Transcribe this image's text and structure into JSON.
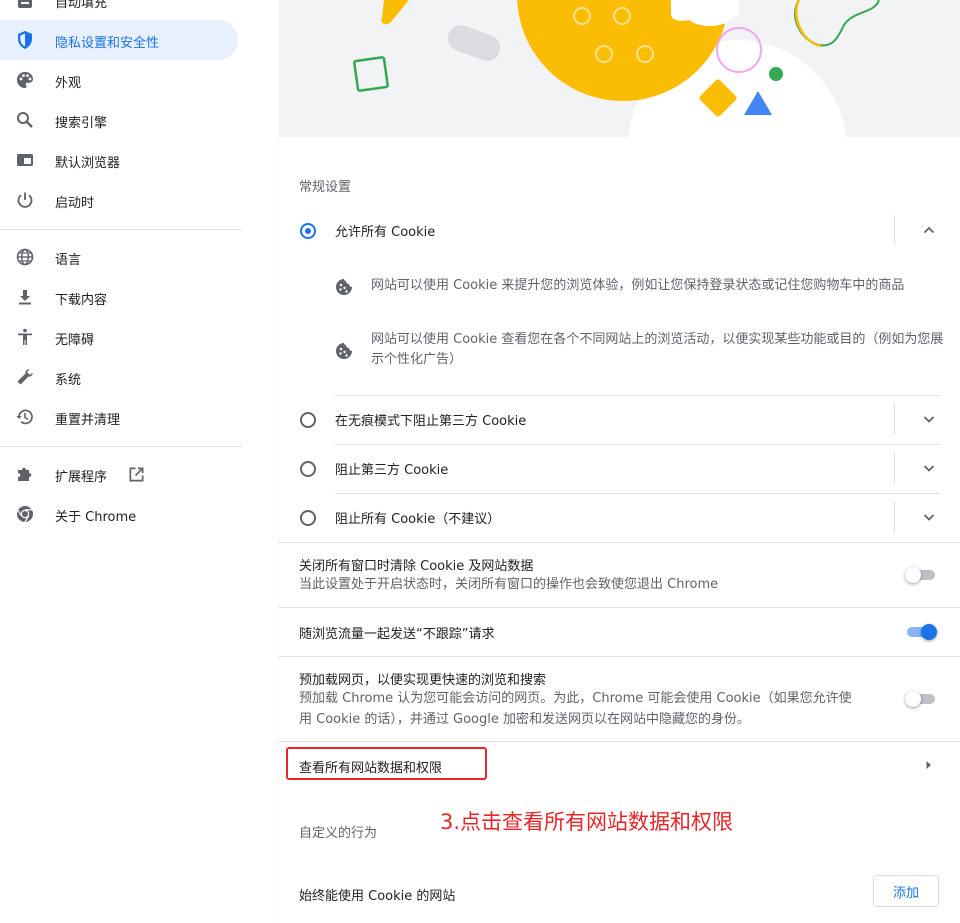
{
  "sidebar": {
    "items": [
      {
        "label": "自动填充"
      },
      {
        "label": "隐私设置和安全性",
        "active": true
      },
      {
        "label": "外观"
      },
      {
        "label": "搜索引擎"
      },
      {
        "label": "默认浏览器"
      },
      {
        "label": "启动时"
      },
      {
        "label": "语言"
      },
      {
        "label": "下载内容"
      },
      {
        "label": "无障碍"
      },
      {
        "label": "系统"
      },
      {
        "label": "重置并清理"
      },
      {
        "label": "扩展程序"
      },
      {
        "label": "关于 Chrome"
      }
    ]
  },
  "main": {
    "general_section_title": "常规设置",
    "cookie_options": [
      {
        "label": "允许所有 Cookie",
        "selected": true,
        "expanded": true
      },
      {
        "label": "在无痕模式下阻止第三方 Cookie",
        "selected": false
      },
      {
        "label": "阻止第三方 Cookie",
        "selected": false
      },
      {
        "label": "阻止所有 Cookie（不建议）",
        "selected": false
      }
    ],
    "allow_details": [
      "网站可以使用 Cookie 来提升您的浏览体验，例如让您保持登录状态或记住您购物车中的商品",
      "网站可以使用 Cookie 查看您在各个不同网站上的浏览活动，以便实现某些功能或目的（例如为您展示个性化广告）"
    ],
    "toggles": [
      {
        "title": "关闭所有窗口时清除 Cookie 及网站数据",
        "subtitle": "当此设置处于开启状态时，关闭所有窗口的操作也会致使您退出 Chrome",
        "on": false
      },
      {
        "title": "随浏览流量一起发送“不跟踪”请求",
        "subtitle": "",
        "on": true
      },
      {
        "title": "预加载网页，以便实现更快速的浏览和搜索",
        "subtitle": "预加载 Chrome 认为您可能会访问的网页。为此，Chrome 可能会使用 Cookie（如果您允许使用 Cookie 的话），并通过 Google 加密和发送网页以在网站中隐藏您的身份。",
        "on": false
      }
    ],
    "site_data_link": "查看所有网站数据和权限",
    "custom_section_title": "自定义的行为",
    "always_allow_label": "始终能使用 Cookie 的网站",
    "add_button": "添加"
  },
  "annotation": "3.点击查看所有网站数据和权限",
  "colors": {
    "accent": "#1a73e8",
    "annotation": "#e8262a",
    "active_bg": "#e8f0fe"
  }
}
